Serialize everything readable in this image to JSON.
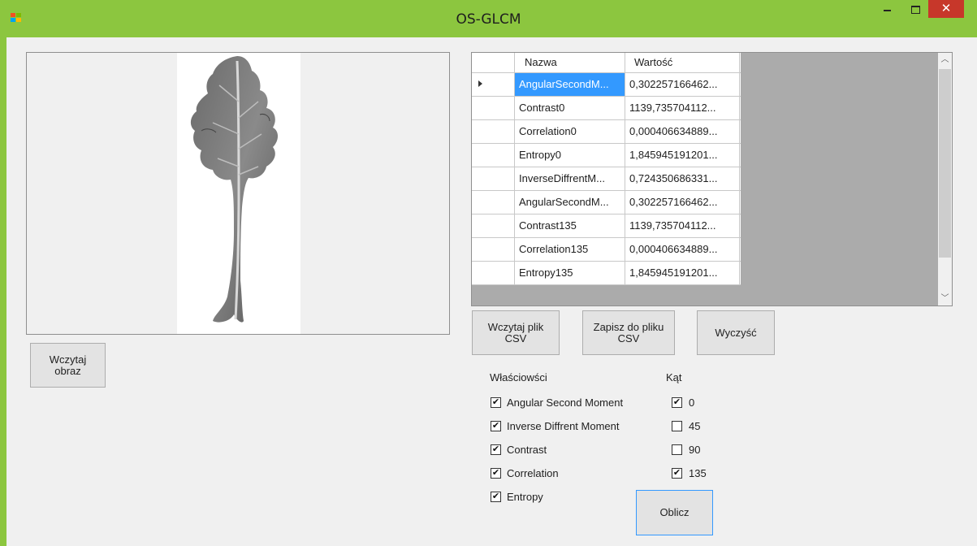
{
  "window": {
    "title": "OS-GLCM",
    "close_glyph": "✕"
  },
  "image_panel": {
    "load_button": "Wczytaj\nobraz"
  },
  "table": {
    "headers": {
      "name": "Nazwa",
      "value": "Wartość"
    },
    "rows": [
      {
        "name": "AngularSecondM...",
        "value": "0,302257166462...",
        "selected": true
      },
      {
        "name": "Contrast0",
        "value": "1139,735704112..."
      },
      {
        "name": "Correlation0",
        "value": "0,000406634889..."
      },
      {
        "name": "Entropy0",
        "value": "1,845945191201..."
      },
      {
        "name": "InverseDiffrentM...",
        "value": "0,724350686331..."
      },
      {
        "name": "AngularSecondM...",
        "value": "0,302257166462..."
      },
      {
        "name": "Contrast135",
        "value": "1139,735704112..."
      },
      {
        "name": "Correlation135",
        "value": "0,000406634889..."
      },
      {
        "name": "Entropy135",
        "value": "1,845945191201..."
      }
    ]
  },
  "buttons": {
    "load_csv": "Wczytaj plik\nCSV",
    "save_csv": "Zapisz do pliku\nCSV",
    "clear": "Wyczyść",
    "compute": "Oblicz"
  },
  "properties": {
    "heading": "Właściowści",
    "items": [
      {
        "label": "Angular Second Moment",
        "checked": true
      },
      {
        "label": "Inverse Diffrent Moment",
        "checked": true
      },
      {
        "label": "Contrast",
        "checked": true
      },
      {
        "label": "Correlation",
        "checked": true
      },
      {
        "label": "Entropy",
        "checked": true
      }
    ]
  },
  "angles": {
    "heading": "Kąt",
    "items": [
      {
        "label": "0",
        "checked": true
      },
      {
        "label": "45",
        "checked": false
      },
      {
        "label": "90",
        "checked": false
      },
      {
        "label": "135",
        "checked": true
      }
    ]
  },
  "check_glyph": "✔",
  "colors": {
    "titlebar": "#8cc63f",
    "close": "#c7372a",
    "selection": "#3399ff"
  }
}
